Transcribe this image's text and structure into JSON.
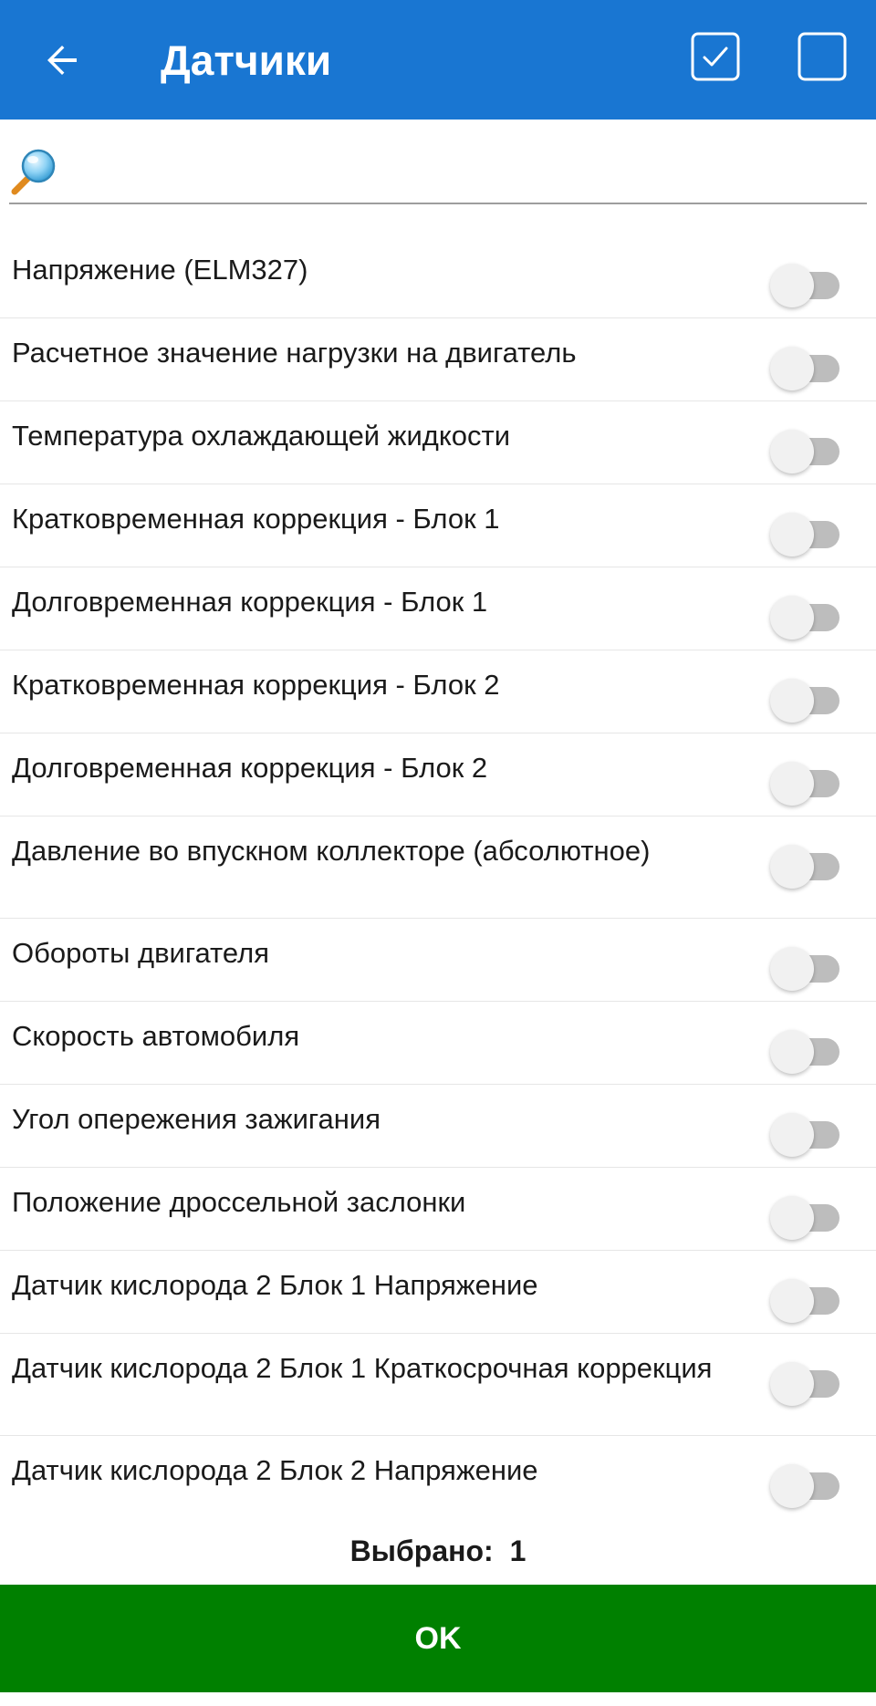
{
  "appbar": {
    "title": "Датчики",
    "background_color": "#1976d2",
    "back_icon": "arrow-back-icon",
    "select_all_icon": "checkbox-checked-icon",
    "deselect_all_icon": "checkbox-empty-icon"
  },
  "search": {
    "icon": "magnifier-icon",
    "value": "",
    "placeholder": ""
  },
  "sensors": [
    {
      "label": "Напряжение (ELM327)",
      "enabled": false
    },
    {
      "label": "Расчетное значение нагрузки на двигатель",
      "enabled": false
    },
    {
      "label": "Температура охлаждающей жидкости",
      "enabled": false
    },
    {
      "label": "Кратковременная коррекция - Блок 1",
      "enabled": false
    },
    {
      "label": "Долговременная коррекция - Блок 1",
      "enabled": false
    },
    {
      "label": "Кратковременная коррекция - Блок 2",
      "enabled": false
    },
    {
      "label": "Долговременная коррекция - Блок 2",
      "enabled": false
    },
    {
      "label": "Давление во впускном коллекторе (абсолютное)",
      "enabled": false
    },
    {
      "label": "Обороты двигателя",
      "enabled": false
    },
    {
      "label": "Скорость автомобиля",
      "enabled": false
    },
    {
      "label": "Угол опережения зажигания",
      "enabled": false
    },
    {
      "label": "Положение дроссельной заслонки",
      "enabled": false
    },
    {
      "label": "Датчик кислорода 2 Блок 1 Напряжение",
      "enabled": false
    },
    {
      "label": "Датчик кислорода 2 Блок 1 Краткосрочная коррекция",
      "enabled": false
    },
    {
      "label": "Датчик кислорода 2 Блок 2 Напряжение",
      "enabled": false
    }
  ],
  "footer": {
    "selected_label": "Выбрано:",
    "selected_count": "1",
    "ok_label": "OK",
    "ok_color": "#008000"
  }
}
